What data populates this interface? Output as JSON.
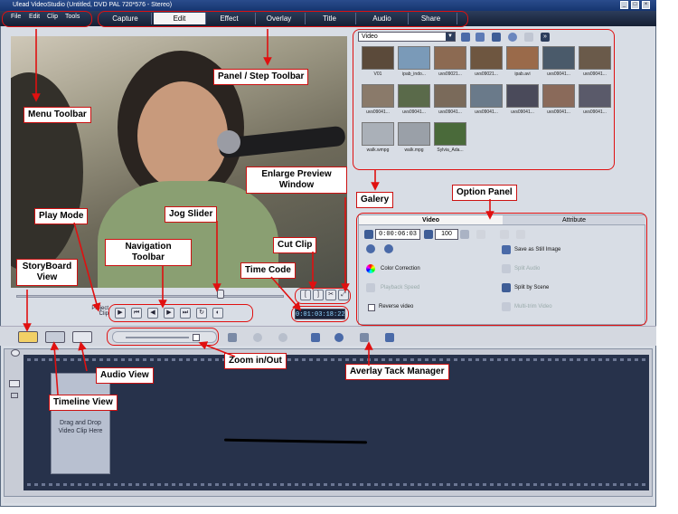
{
  "window": {
    "title": "Ulead VideoStudio (Untitled, DVD PAL 720*576 - Stereo)",
    "controls": [
      "_",
      "□",
      "×"
    ]
  },
  "menu": [
    "File",
    "Edit",
    "Clip",
    "Tools"
  ],
  "steps": [
    {
      "label": "Capture",
      "active": false
    },
    {
      "label": "Edit",
      "active": true
    },
    {
      "label": "Effect",
      "active": false
    },
    {
      "label": "Overlay",
      "active": false
    },
    {
      "label": "Title",
      "active": false
    },
    {
      "label": "Audio",
      "active": false
    },
    {
      "label": "Share",
      "active": false
    }
  ],
  "library": {
    "dropdown": "Video",
    "thumbs": [
      "V01",
      "ipab_indo...",
      "uvs09021...",
      "uvs09021...",
      "ipab.avi",
      "uvs09041...",
      "uvs09041...",
      "uvs09041...",
      "uvs09041...",
      "uvs09041...",
      "uvs09041...",
      "uvs09041...",
      "uvs09041...",
      "uvs09041...",
      "walk.wmpg",
      "walk.mpg",
      "Sylvia_Ada..."
    ]
  },
  "options": {
    "tabs": [
      "Video",
      "Attribute"
    ],
    "timecode": "0:00:06:03",
    "volume": "100",
    "save_still": "Save as Still Image",
    "color_correction": "Color Correction",
    "split_audio": "Split Audio",
    "playback_speed": "Playback Speed",
    "split_by_scene": "Split by Scene",
    "reverse_video": "Reverse video",
    "multi_trim": "Multi-trim Video"
  },
  "play_mode": {
    "project": "Project",
    "clip": "Clip"
  },
  "time_code": "0:01:03:18:22",
  "timeline": {
    "placeholder": "Drag and Drop Video Clip Here"
  },
  "annotations": {
    "menu_toolbar": "Menu Toolbar",
    "panel_step_toolbar": "Panel / Step Toolbar",
    "enlarge_preview": "Enlarge Preview Window",
    "galery": "Galery",
    "option_panel": "Option Panel",
    "play_mode": "Play Mode",
    "jog_slider": "Jog Slider",
    "navigation_toolbar": "Navigation Toolbar",
    "cut_clip": "Cut Clip",
    "storyboard_view": "StoryBoard View",
    "time_code": "Time Code",
    "audio_view": "Audio View",
    "zoom": "Zoom in/Out",
    "overlay_track": "Averlay Tack Manager",
    "timeline_view": "Timeline View"
  },
  "colors": {
    "accent_red": "#e01010",
    "menubar": "#1f2b44",
    "track": "#27324b"
  }
}
